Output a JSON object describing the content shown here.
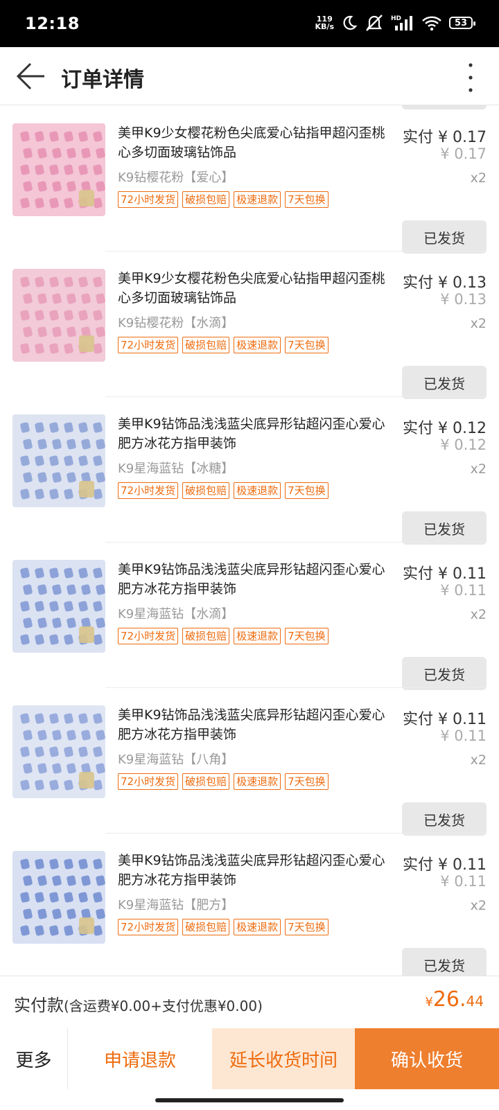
{
  "status_bar": {
    "time": "12:18",
    "speed_value": "119",
    "speed_unit": "KB/s",
    "battery": "53",
    "icons": [
      "moon-icon",
      "mute-icon",
      "hd-signal-icon",
      "wifi-icon",
      "battery-icon"
    ]
  },
  "header": {
    "title": "订单详情",
    "back_icon": "arrow-left-icon",
    "menu_icon": "more-vertical-icon"
  },
  "tags": [
    "72小时发货",
    "破损包赔",
    "极速退款",
    "7天包换"
  ],
  "items": [
    {
      "title": "美甲K9少女樱花粉色尖底爱心钻指甲超闪歪桃心多切面玻璃钻饰品",
      "sku": "K9钻樱花粉【爱心】",
      "paid": "实付 ¥ 0.17",
      "orig": "¥ 0.17",
      "qty": "x2",
      "status": "已发货",
      "thumb_color": "#f4c6d6",
      "gem_color": "#e58fb0"
    },
    {
      "title": "美甲K9少女樱花粉色尖底爱心钻指甲超闪歪桃心多切面玻璃钻饰品",
      "sku": "K9钻樱花粉【水滴】",
      "paid": "实付 ¥ 0.13",
      "orig": "¥ 0.13",
      "qty": "x2",
      "status": "已发货",
      "thumb_color": "#f2cad8",
      "gem_color": "#e79cb8"
    },
    {
      "title": "美甲K9钻饰品浅浅蓝尖底异形钻超闪歪心爱心肥方冰花方指甲装饰",
      "sku": "K9星海蓝钻【冰糖】",
      "paid": "实付 ¥ 0.12",
      "orig": "¥ 0.12",
      "qty": "x2",
      "status": "已发货",
      "thumb_color": "#dde3f1",
      "gem_color": "#8aa0d6"
    },
    {
      "title": "美甲K9钻饰品浅浅蓝尖底异形钻超闪歪心爱心肥方冰花方指甲装饰",
      "sku": "K9星海蓝钻【水滴】",
      "paid": "实付 ¥ 0.11",
      "orig": "¥ 0.11",
      "qty": "x2",
      "status": "已发货",
      "thumb_color": "#dbe2f2",
      "gem_color": "#7f97d4"
    },
    {
      "title": "美甲K9钻饰品浅浅蓝尖底异形钻超闪歪心爱心肥方冰花方指甲装饰",
      "sku": "K9星海蓝钻【八角】",
      "paid": "实付 ¥ 0.11",
      "orig": "¥ 0.11",
      "qty": "x2",
      "status": "已发货",
      "thumb_color": "#dfe5f3",
      "gem_color": "#8da2d8"
    },
    {
      "title": "美甲K9钻饰品浅浅蓝尖底异形钻超闪歪心爱心肥方冰花方指甲装饰",
      "sku": "K9星海蓝钻【肥方】",
      "paid": "实付 ¥ 0.11",
      "orig": "¥ 0.11",
      "qty": "x2",
      "status": "已发货",
      "thumb_color": "#d9e0f2",
      "gem_color": "#6f8bd0"
    }
  ],
  "summary": {
    "label": "实付款",
    "detail": "(含运费¥0.00+支付优惠¥0.00)",
    "currency": "¥",
    "amount_int": "26.",
    "amount_dec": "44"
  },
  "actions": {
    "more": "更多",
    "refund": "申请退款",
    "extend": "延长收货时间",
    "confirm": "确认收货"
  },
  "colors": {
    "accent": "#ee6b0e",
    "confirm_bg": "#ee7f2f",
    "extend_bg": "#fde7d3"
  }
}
